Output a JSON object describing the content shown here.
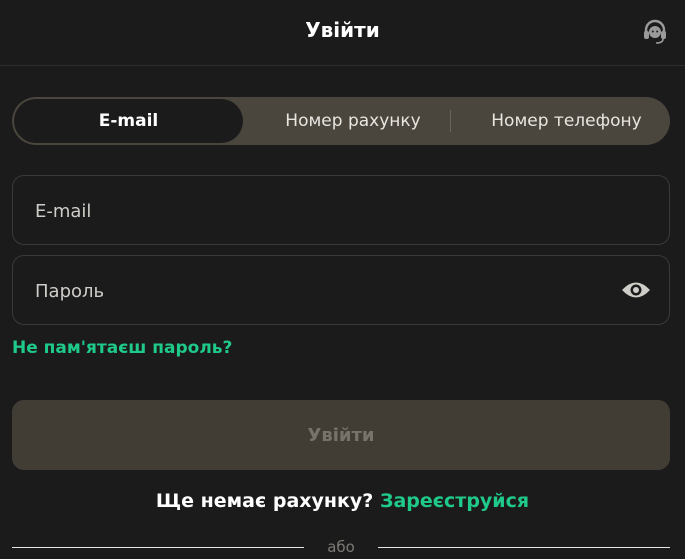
{
  "header": {
    "title": "Увійти",
    "support_icon": "headset-icon"
  },
  "tabs": [
    {
      "label": "E-mail",
      "active": true
    },
    {
      "label": "Номер рахунку",
      "active": false
    },
    {
      "label": "Номер телефону",
      "active": false
    }
  ],
  "form": {
    "email": {
      "placeholder": "E-mail",
      "value": ""
    },
    "password": {
      "placeholder": "Пароль",
      "value": "",
      "toggle_icon": "eye-icon"
    },
    "forgot_label": "Не пам'ятаєш пароль?",
    "submit_label": "Увійти"
  },
  "register": {
    "question": "Ще немає рахунку?",
    "link": "Зареєструйся"
  },
  "divider": {
    "label": "або"
  },
  "colors": {
    "background": "#1b1b1b",
    "accent_green": "#1fc98a",
    "tab_bg": "#4a463e",
    "button_disabled_bg": "#413d35"
  }
}
